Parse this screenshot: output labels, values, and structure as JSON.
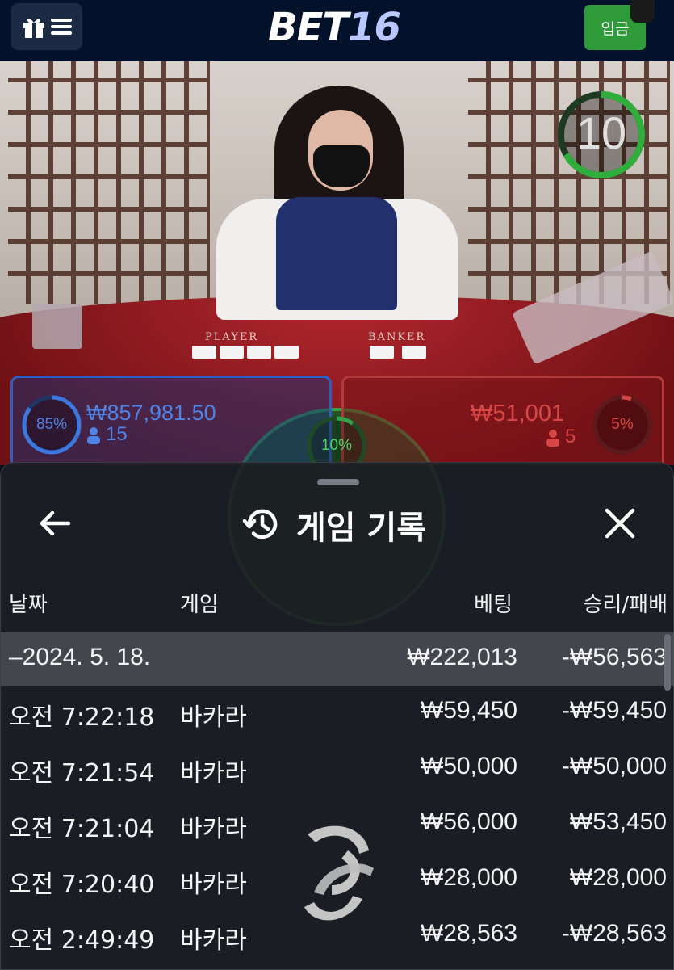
{
  "header": {
    "logo_bet": "BET",
    "logo_num": "16",
    "deposit_label": "입금"
  },
  "video": {
    "timer": "10",
    "player_label": "PLAYER",
    "banker_label": "BANKER",
    "player_pct": "85%",
    "player_amount": "₩857,981.50",
    "player_count": "15",
    "banker_pct": "5%",
    "banker_amount": "₩51,001",
    "banker_count": "5",
    "tie_pct": "10%",
    "player_pct_value": 0.85,
    "banker_pct_value": 0.05,
    "tie_pct_value": 0.1
  },
  "history": {
    "title": "게임 기록",
    "columns": {
      "date": "날짜",
      "game": "게임",
      "bet": "베팅",
      "winloss": "승리/패배"
    },
    "summary": {
      "date": "–2024. 5. 18.",
      "bet": "₩222,013",
      "winloss": "-₩56,563"
    },
    "rows": [
      {
        "time": "오전 7:22:18",
        "game": "바카라",
        "bet": "₩59,450",
        "winloss": "-₩59,450"
      },
      {
        "time": "오전 7:21:54",
        "game": "바카라",
        "bet": "₩50,000",
        "winloss": "-₩50,000"
      },
      {
        "time": "오전 7:21:04",
        "game": "바카라",
        "bet": "₩56,000",
        "winloss": "₩53,450"
      },
      {
        "time": "오전 7:20:40",
        "game": "바카라",
        "bet": "₩28,000",
        "winloss": "₩28,000"
      },
      {
        "time": "오전 2:49:49",
        "game": "바카라",
        "bet": "₩28,563",
        "winloss": "-₩28,563"
      }
    ]
  },
  "icons": {
    "gift": "gift-icon",
    "menu": "hamburger-icon",
    "back": "arrow-left-icon",
    "history": "history-icon",
    "close": "close-icon",
    "loader": "loading-spinner-icon",
    "person": "person-icon"
  },
  "colors": {
    "deposit": "#2f9a3a",
    "player": "#4f83e6",
    "banker": "#d84646",
    "tie": "#36a24a",
    "timer": "#2fae3c"
  }
}
